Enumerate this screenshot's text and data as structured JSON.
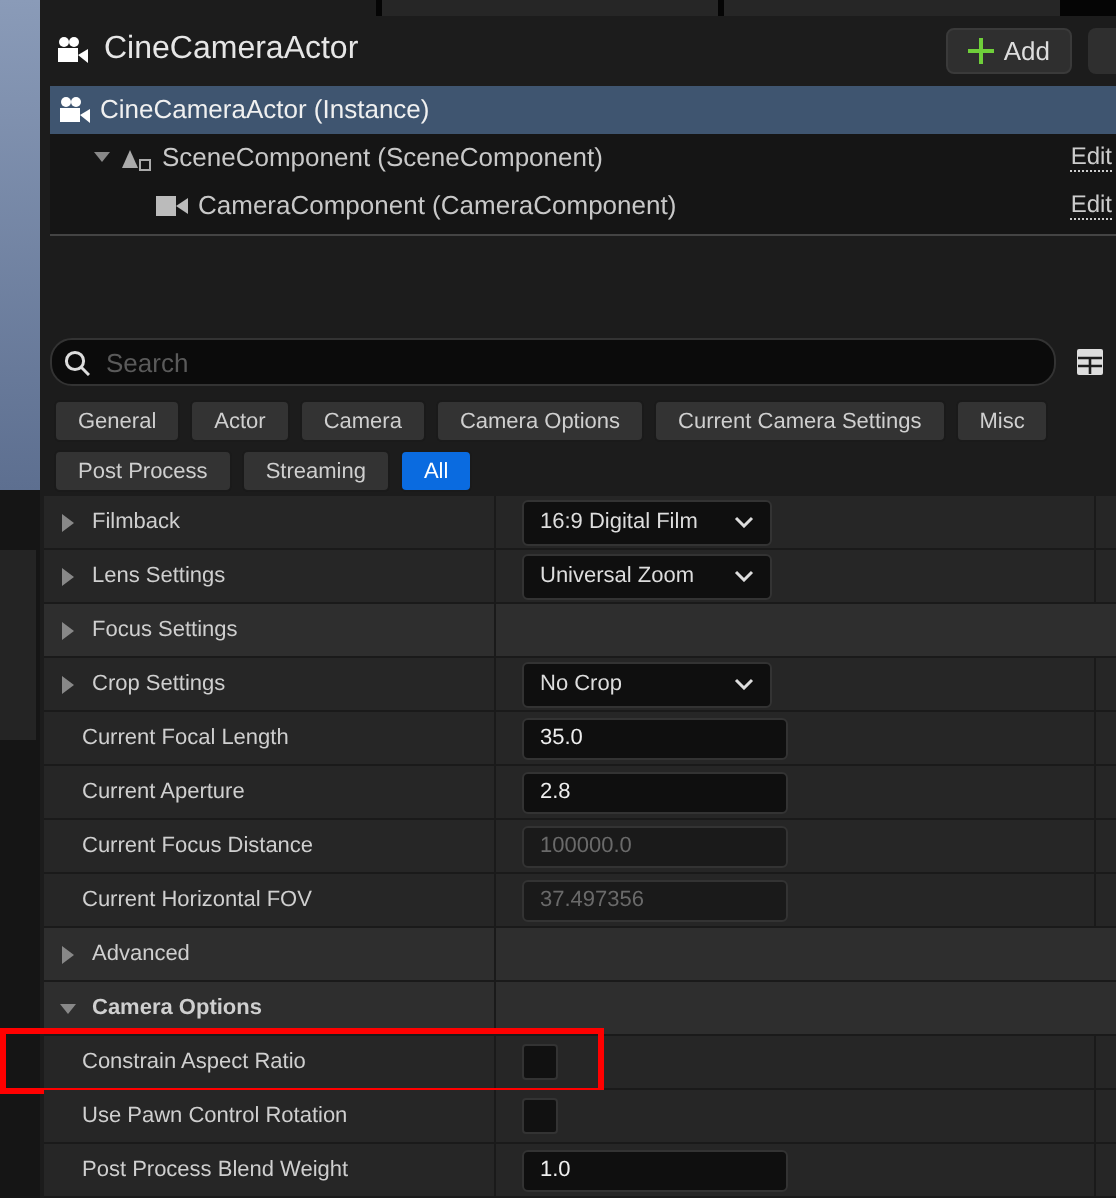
{
  "header": {
    "title": "CineCameraActor",
    "add_button": "Add"
  },
  "components": [
    {
      "label": "CineCameraActor (Instance)",
      "selected": true,
      "kind": "actor",
      "children": [
        {
          "label": "SceneComponent (SceneComponent)",
          "selected": false,
          "kind": "scene",
          "expanded": true,
          "edit": "Edit",
          "children": [
            {
              "label": "CameraComponent (CameraComponent)",
              "selected": false,
              "kind": "camera",
              "edit": "Edit"
            }
          ]
        }
      ]
    }
  ],
  "search": {
    "placeholder": "Search"
  },
  "categories": [
    [
      {
        "label": "General",
        "selected": false
      },
      {
        "label": "Actor",
        "selected": false
      },
      {
        "label": "Camera",
        "selected": false
      },
      {
        "label": "Camera Options",
        "selected": false
      },
      {
        "label": "Current Camera Settings",
        "selected": false
      },
      {
        "label": "Misc",
        "selected": false
      }
    ],
    [
      {
        "label": "Post Process",
        "selected": false
      },
      {
        "label": "Streaming",
        "selected": false
      },
      {
        "label": "All",
        "selected": true
      }
    ]
  ],
  "properties": [
    {
      "kind": "dropdown",
      "name": "Filmback",
      "expandable": true,
      "value": "16:9 Digital Film"
    },
    {
      "kind": "dropdown",
      "name": "Lens Settings",
      "expandable": true,
      "value": "Universal Zoom"
    },
    {
      "kind": "group",
      "name": "Focus Settings",
      "expandable": true
    },
    {
      "kind": "dropdown",
      "name": "Crop Settings",
      "expandable": true,
      "value": "No Crop"
    },
    {
      "kind": "number",
      "name": "Current Focal Length",
      "value": "35.0",
      "disabled": false
    },
    {
      "kind": "number",
      "name": "Current Aperture",
      "value": "2.8",
      "disabled": false
    },
    {
      "kind": "number",
      "name": "Current Focus Distance",
      "value": "100000.0",
      "disabled": true
    },
    {
      "kind": "number",
      "name": "Current Horizontal FOV",
      "value": "37.497356",
      "disabled": true
    },
    {
      "kind": "group",
      "name": "Advanced",
      "expandable": true
    },
    {
      "kind": "section",
      "name": "Camera Options",
      "expanded": true
    },
    {
      "kind": "checkbox",
      "name": "Constrain Aspect Ratio",
      "checked": false,
      "highlighted": true
    },
    {
      "kind": "checkbox",
      "name": "Use Pawn Control Rotation",
      "checked": false
    },
    {
      "kind": "number",
      "name": "Post Process Blend Weight",
      "value": "1.0",
      "disabled": false
    }
  ]
}
